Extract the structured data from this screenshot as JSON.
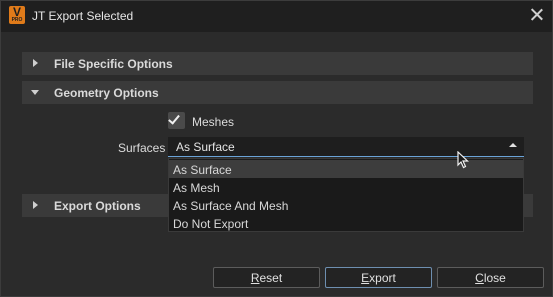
{
  "window": {
    "title": "JT Export Selected",
    "app_icon": {
      "letter": "V",
      "sub": "PRO"
    }
  },
  "sections": {
    "file_specific": "File Specific Options",
    "geometry": "Geometry Options",
    "export": "Export Options"
  },
  "geometry": {
    "meshes_label": "Meshes",
    "meshes_checked": true,
    "surfaces_label": "Surfaces",
    "surfaces_value": "As Surface",
    "surfaces_options": [
      "As Surface",
      "As Mesh",
      "As Surface And Mesh",
      "Do Not Export"
    ],
    "surfaces_highlighted": "As Surface"
  },
  "buttons": {
    "reset": {
      "first": "R",
      "rest": "eset"
    },
    "export": {
      "first": "E",
      "rest": "xport"
    },
    "close": {
      "first": "C",
      "rest": "lose"
    }
  },
  "colors": {
    "accent_orange": "#e07b1a",
    "focus_blue": "#6aa3d8"
  }
}
